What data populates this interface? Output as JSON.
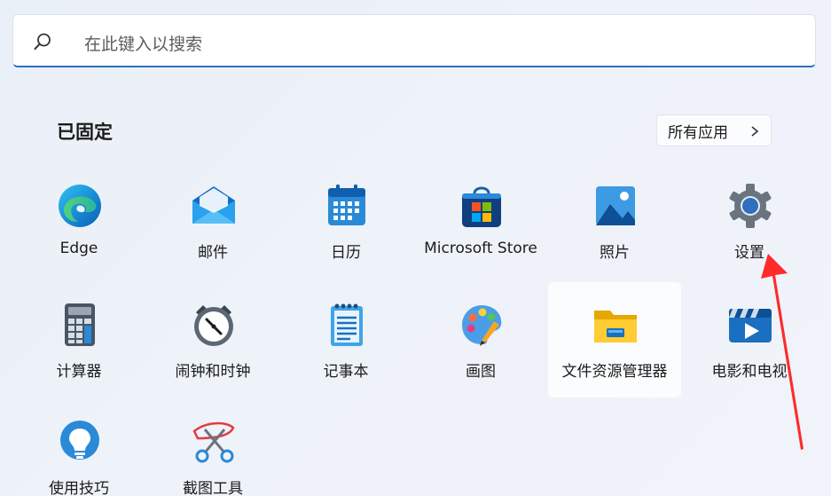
{
  "search": {
    "placeholder": "在此键入以搜索"
  },
  "pinned": {
    "title": "已固定",
    "all_apps_label": "所有应用",
    "apps": [
      {
        "label": "Edge",
        "icon": "edge-icon"
      },
      {
        "label": "邮件",
        "icon": "mail-icon"
      },
      {
        "label": "日历",
        "icon": "calendar-icon"
      },
      {
        "label": "Microsoft Store",
        "icon": "store-icon"
      },
      {
        "label": "照片",
        "icon": "photos-icon"
      },
      {
        "label": "设置",
        "icon": "settings-gear-icon"
      },
      {
        "label": "计算器",
        "icon": "calculator-icon"
      },
      {
        "label": "闹钟和时钟",
        "icon": "alarm-clock-icon"
      },
      {
        "label": "记事本",
        "icon": "notepad-icon"
      },
      {
        "label": "画图",
        "icon": "paint-icon"
      },
      {
        "label": "文件资源管理器",
        "icon": "folder-icon"
      },
      {
        "label": "电影和电视",
        "icon": "movies-tv-icon"
      },
      {
        "label": "使用技巧",
        "icon": "tips-lightbulb-icon"
      },
      {
        "label": "截图工具",
        "icon": "snipping-tool-icon"
      }
    ]
  },
  "annotation": {
    "color": "#ff2a2a"
  }
}
